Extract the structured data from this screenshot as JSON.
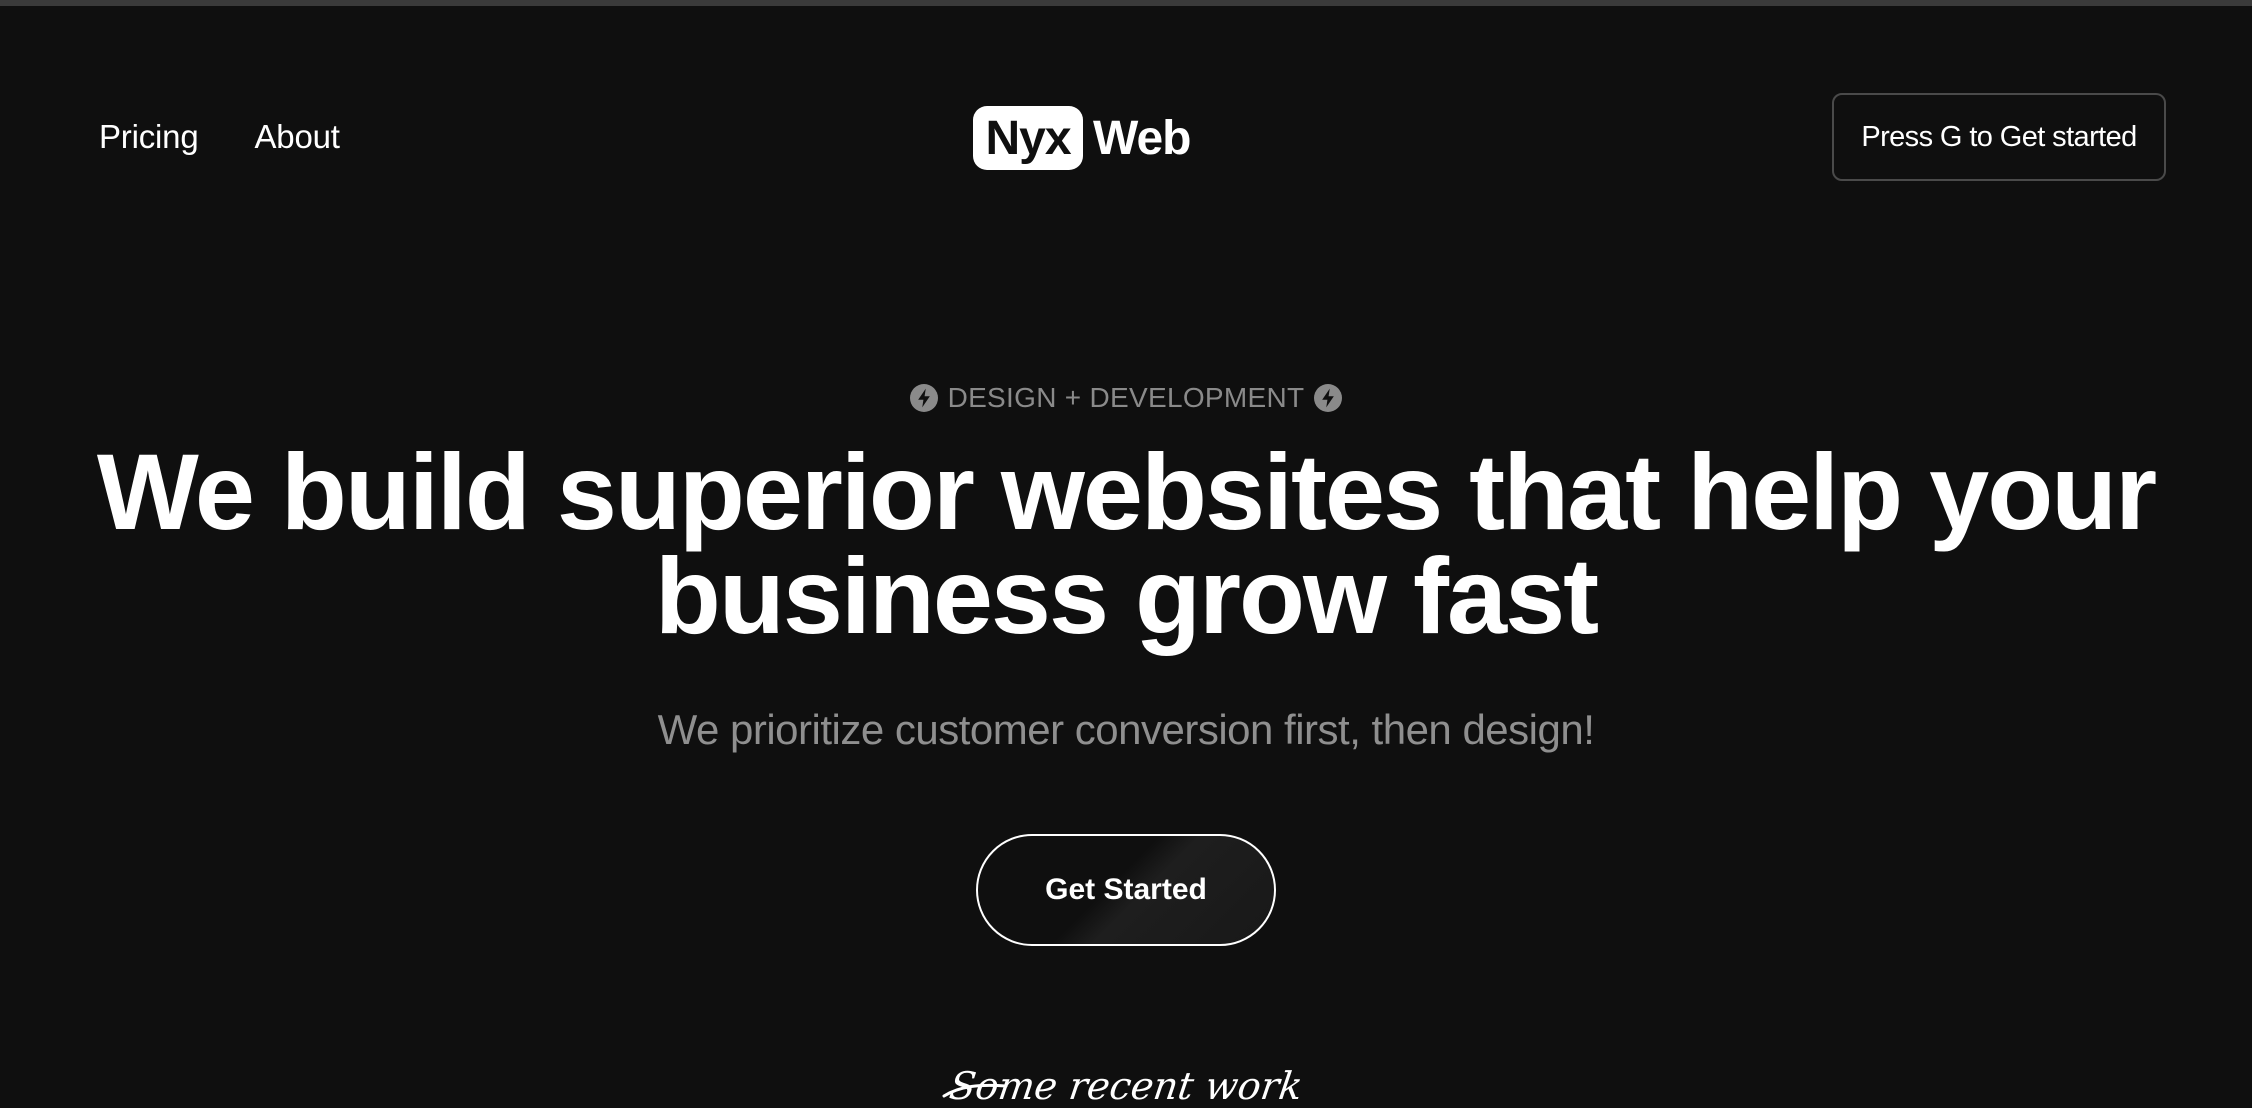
{
  "nav": {
    "links": [
      {
        "label": "Pricing"
      },
      {
        "label": "About"
      }
    ],
    "cta_label": "Press G to Get started"
  },
  "logo": {
    "box_text": "Nyx",
    "text": "Web"
  },
  "hero": {
    "eyebrow": "DESIGN + DEVELOPMENT",
    "headline_line1": "We build superior websites that help your",
    "headline_line2": "business grow fast",
    "subheadline": "We prioritize customer conversion first, then design!",
    "button_label": "Get Started"
  },
  "recent_work": {
    "label": "Some recent work"
  },
  "icons": {
    "eyebrow_left": "lightning-bolt-icon",
    "eyebrow_right": "lightning-bolt-icon"
  },
  "colors": {
    "background": "#0f0f0f",
    "text_primary": "#ffffff",
    "text_muted": "#8f8f8f",
    "border": "#4a4a4a"
  }
}
